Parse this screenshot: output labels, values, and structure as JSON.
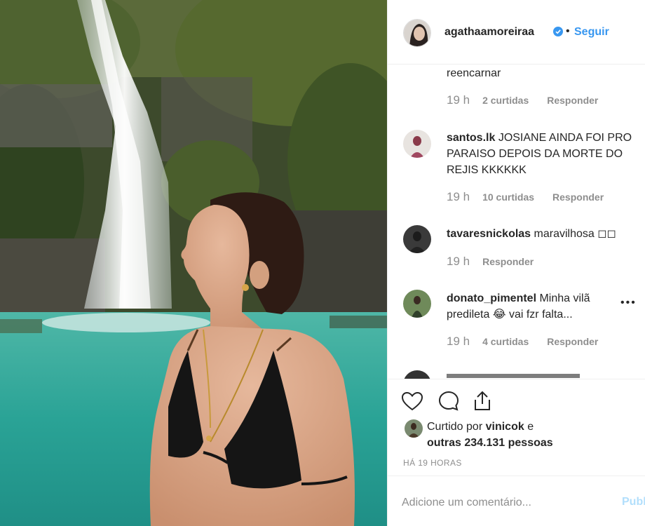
{
  "header": {
    "username": "agathaamoreiraa",
    "separator": "•",
    "follow_label": "Seguir",
    "verified_icon": "verified-badge-icon"
  },
  "comments": [
    {
      "username": "",
      "text": "reencarnar",
      "time": "19 h",
      "likes": "2 curtidas",
      "reply": "Responder"
    },
    {
      "username": "santos.lk",
      "text": "JOSIANE AINDA FOI PRO PARAISO DEPOIS DA MORTE DO REJIS KKKKKK",
      "time": "19 h",
      "likes": "10 curtidas",
      "reply": "Responder"
    },
    {
      "username": "tavaresnickolas",
      "text": "maravilhosa ◻◻",
      "time": "19 h",
      "likes": "",
      "reply": "Responder"
    },
    {
      "username": "donato_pimentel",
      "text": "Minha vilã predileta 😂 vai fzr falta...",
      "time": "19 h",
      "likes": "4 curtidas",
      "reply": "Responder"
    }
  ],
  "more_options": "•••",
  "actions": {
    "like_icon": "heart-icon",
    "comment_icon": "comment-icon",
    "share_icon": "share-icon"
  },
  "likes_summary": {
    "prefix": "Curtido por",
    "user": "vinicok",
    "connector": "e",
    "others": "outras 234.131 pessoas"
  },
  "timestamp": "HÁ 19 HORAS",
  "comment_input": {
    "placeholder": "Adicione um comentário...",
    "post_label": "Publicar"
  },
  "colors": {
    "accent": "#3897f0",
    "muted": "#8e8e8e",
    "text": "#262626",
    "post_disabled": "#b2dffc"
  }
}
